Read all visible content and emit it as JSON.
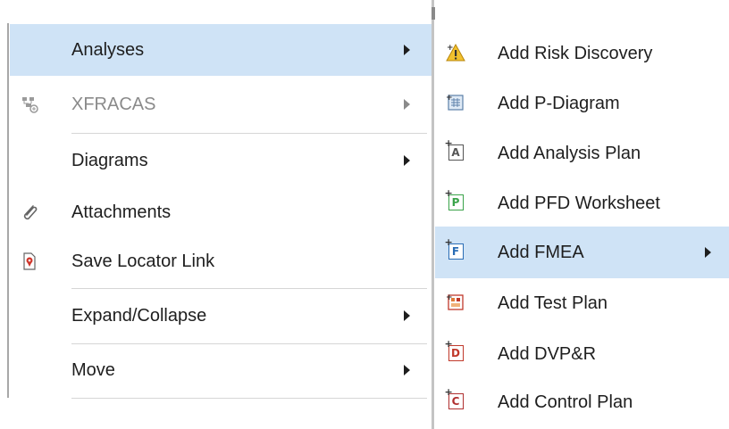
{
  "left_menu": {
    "items": [
      {
        "label": "Analyses",
        "submenu": true,
        "highlighted": true,
        "icon": ""
      },
      {
        "label": "XFRACAS",
        "submenu": true,
        "disabled": true,
        "icon": "xfracas-icon"
      },
      {
        "label": "Diagrams",
        "submenu": true,
        "icon": ""
      },
      {
        "label": "Attachments",
        "submenu": false,
        "icon": "paperclip-icon"
      },
      {
        "label": "Save Locator Link",
        "submenu": false,
        "icon": "locator-link-icon"
      },
      {
        "label": "Expand/Collapse",
        "submenu": true,
        "icon": ""
      },
      {
        "label": "Move",
        "submenu": true,
        "icon": ""
      }
    ]
  },
  "right_menu": {
    "items": [
      {
        "label": "Add Risk Discovery",
        "icon": "risk-discovery-icon"
      },
      {
        "label": "Add P-Diagram",
        "icon": "p-diagram-icon"
      },
      {
        "label": "Add Analysis Plan",
        "icon": "analysis-plan-icon",
        "icon_letter": "A",
        "icon_color": "#555555"
      },
      {
        "label": "Add PFD Worksheet",
        "icon": "pfd-worksheet-icon",
        "icon_letter": "P",
        "icon_color": "#3aa34a"
      },
      {
        "label": "Add FMEA",
        "icon": "fmea-icon",
        "icon_letter": "F",
        "icon_color": "#2a6db5",
        "submenu": true,
        "highlighted": true
      },
      {
        "label": "Add Test Plan",
        "icon": "test-plan-icon"
      },
      {
        "label": "Add DVP&R",
        "icon": "dvpr-icon",
        "icon_letter": "D",
        "icon_color": "#c0392b"
      },
      {
        "label": "Add Control Plan",
        "icon": "control-plan-icon",
        "icon_letter": "C",
        "icon_color": "#b03030"
      }
    ]
  },
  "colors": {
    "highlight": "#cfe3f6",
    "disabled_text": "#8a8a8a",
    "text": "#1e1e1e"
  }
}
